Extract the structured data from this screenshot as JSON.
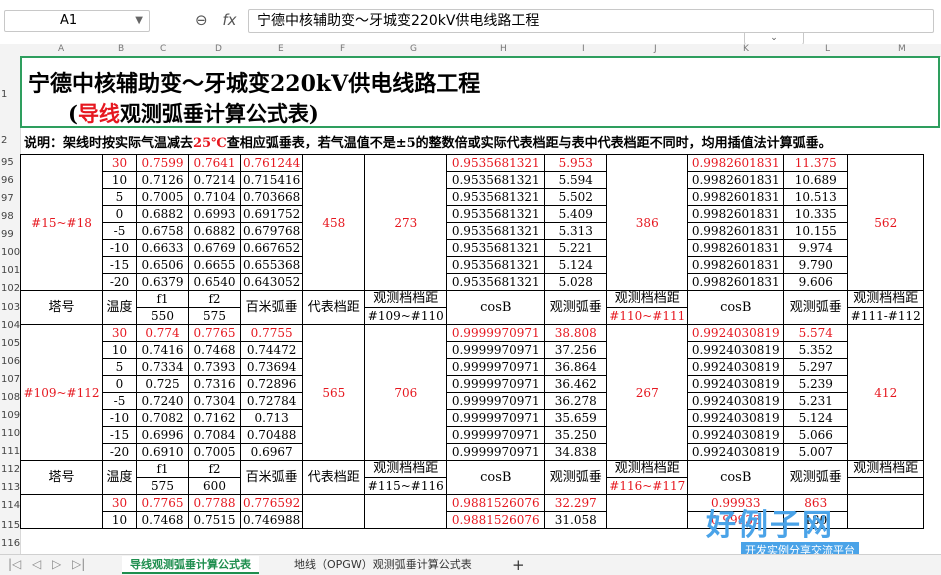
{
  "formula_bar": {
    "cell_ref": "A1",
    "fx_label": "fx",
    "content": "宁德中核辅助变～牙城变220kV供电线路工程"
  },
  "columns": [
    "A",
    "B",
    "C",
    "D",
    "E",
    "F",
    "G",
    "H",
    "I",
    "J",
    "K",
    "L",
    "M"
  ],
  "rows_visible": [
    "1",
    "2",
    "95",
    "96",
    "97",
    "98",
    "99",
    "100",
    "101",
    "102",
    "103",
    "104",
    "105",
    "106",
    "107",
    "108",
    "109",
    "110",
    "111",
    "112",
    "113",
    "114",
    "115",
    "116"
  ],
  "title": {
    "line1": "宁德中核辅助变～牙城变220kV供电线路工程",
    "open_paren": "(",
    "red_word": "导线",
    "line2_rest": "观测弧垂计算公式表)"
  },
  "note": {
    "part1": "说明：架线时按实际气温减去",
    "red_temp": "25℃",
    "part2": "查相应弧垂表，若气温值不是±5的整数倍或实际代表档距与表中代表档距不同时，均用插值法计算弧垂。"
  },
  "block1": {
    "tower": "#15~#18",
    "span": "458",
    "obs1": "273",
    "obs2": "386",
    "obs3": "562",
    "rows": [
      {
        "t": "30",
        "f1": "0.7599",
        "f2": "0.7641",
        "h": "0.761244",
        "c1": "0.9535681321",
        "s1": "5.953",
        "c2": "0.9982601831",
        "s2": "11.375"
      },
      {
        "t": "10",
        "f1": "0.7126",
        "f2": "0.7214",
        "h": "0.715416",
        "c1": "0.9535681321",
        "s1": "5.594",
        "c2": "0.9982601831",
        "s2": "10.689"
      },
      {
        "t": "5",
        "f1": "0.7005",
        "f2": "0.7104",
        "h": "0.703668",
        "c1": "0.9535681321",
        "s1": "5.502",
        "c2": "0.9982601831",
        "s2": "10.513"
      },
      {
        "t": "0",
        "f1": "0.6882",
        "f2": "0.6993",
        "h": "0.691752",
        "c1": "0.9535681321",
        "s1": "5.409",
        "c2": "0.9982601831",
        "s2": "10.335"
      },
      {
        "t": "-5",
        "f1": "0.6758",
        "f2": "0.6882",
        "h": "0.679768",
        "c1": "0.9535681321",
        "s1": "5.313",
        "c2": "0.9982601831",
        "s2": "10.155"
      },
      {
        "t": "-10",
        "f1": "0.6633",
        "f2": "0.6769",
        "h": "0.667652",
        "c1": "0.9535681321",
        "s1": "5.221",
        "c2": "0.9982601831",
        "s2": "9.974"
      },
      {
        "t": "-15",
        "f1": "0.6506",
        "f2": "0.6655",
        "h": "0.655368",
        "c1": "0.9535681321",
        "s1": "5.124",
        "c2": "0.9982601831",
        "s2": "9.790"
      },
      {
        "t": "-20",
        "f1": "0.6379",
        "f2": "0.6540",
        "h": "0.643052",
        "c1": "0.9535681321",
        "s1": "5.028",
        "c2": "0.9982601831",
        "s2": "9.606"
      }
    ]
  },
  "header1": {
    "tower": "塔号",
    "temp": "温度",
    "f1": "f1",
    "f2": "f2",
    "f1v": "550",
    "f2v": "575",
    "hundred": "百米弧垂",
    "rep_span": "代表档距",
    "obs_label": "观测档档距",
    "obs1_range": "#109~#110",
    "cosb": "cosB",
    "obs_sag": "观测弧垂",
    "obs2_range": "#110~#111",
    "obs3_range": "#111-#112"
  },
  "block2": {
    "tower": "#109~#112",
    "span": "565",
    "obs1": "706",
    "obs2": "267",
    "obs3": "412",
    "rows": [
      {
        "t": "30",
        "f1": "0.774",
        "f2": "0.7765",
        "h": "0.7755",
        "c1": "0.9999970971",
        "s1": "38.808",
        "c2": "0.9924030819",
        "s2": "5.574"
      },
      {
        "t": "10",
        "f1": "0.7416",
        "f2": "0.7468",
        "h": "0.74472",
        "c1": "0.9999970971",
        "s1": "37.256",
        "c2": "0.9924030819",
        "s2": "5.352"
      },
      {
        "t": "5",
        "f1": "0.7334",
        "f2": "0.7393",
        "h": "0.73694",
        "c1": "0.9999970971",
        "s1": "36.864",
        "c2": "0.9924030819",
        "s2": "5.297"
      },
      {
        "t": "0",
        "f1": "0.725",
        "f2": "0.7316",
        "h": "0.72896",
        "c1": "0.9999970971",
        "s1": "36.462",
        "c2": "0.9924030819",
        "s2": "5.239"
      },
      {
        "t": "-5",
        "f1": "0.7240",
        "f2": "0.7304",
        "h": "0.72784",
        "c1": "0.9999970971",
        "s1": "36.278",
        "c2": "0.9924030819",
        "s2": "5.231"
      },
      {
        "t": "-10",
        "f1": "0.7082",
        "f2": "0.7162",
        "h": "0.713",
        "c1": "0.9999970971",
        "s1": "35.659",
        "c2": "0.9924030819",
        "s2": "5.124"
      },
      {
        "t": "-15",
        "f1": "0.6996",
        "f2": "0.7084",
        "h": "0.70488",
        "c1": "0.9999970971",
        "s1": "35.250",
        "c2": "0.9924030819",
        "s2": "5.066"
      },
      {
        "t": "-20",
        "f1": "0.6910",
        "f2": "0.7005",
        "h": "0.6967",
        "c1": "0.9999970971",
        "s1": "34.838",
        "c2": "0.9924030819",
        "s2": "5.007"
      }
    ]
  },
  "header2": {
    "tower": "塔号",
    "temp": "温度",
    "f1": "f1",
    "f2": "f2",
    "f1v": "575",
    "f2v": "600",
    "hundred": "百米弧垂",
    "rep_span": "代表档距",
    "obs_label": "观测档档距",
    "obs1_range": "#115~#116",
    "cosb": "cosB",
    "obs_sag": "观测弧垂",
    "obs2_range": "#116~#117",
    "obs3_label": "观测档档距"
  },
  "block3": {
    "rows": [
      {
        "t": "30",
        "f1": "0.7765",
        "f2": "0.7788",
        "h": "0.776592",
        "c1": "0.9881526076",
        "s1": "32.297",
        "c2": "0.99933",
        "s2": "863"
      },
      {
        "t": "10",
        "f1": "0.7468",
        "f2": "0.7515",
        "h": "0.746988",
        "c1": "0.9881526076",
        "s1": "31.058",
        "c2": "0.99933",
        "s2": "180"
      }
    ]
  },
  "sheet_tabs": {
    "active": "导线观测弧垂计算公式表",
    "other": "地线（OPGW）观测弧垂计算公式表",
    "add": "+"
  },
  "watermark": {
    "big": "好例子网",
    "small": "开发实例分享交流平台",
    "url": "www.haolizi.net"
  }
}
